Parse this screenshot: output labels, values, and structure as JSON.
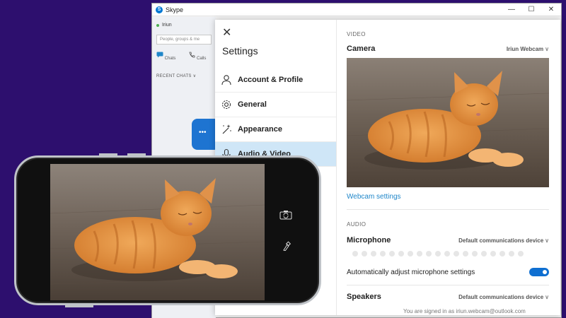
{
  "window": {
    "title": "Skype",
    "controls": [
      "—",
      "☐",
      "✕"
    ]
  },
  "left_panel": {
    "user_name": "Iriun",
    "search_placeholder": "People, groups & me",
    "nav": [
      {
        "label": "Chats",
        "icon": "chat-icon"
      },
      {
        "label": "Calls",
        "icon": "phone-icon"
      }
    ],
    "recent_label": "RECENT CHATS ∨"
  },
  "settings": {
    "close": "✕",
    "title": "Settings",
    "items": [
      {
        "label": "Account & Profile",
        "icon": "person-icon"
      },
      {
        "label": "General",
        "icon": "gear-icon"
      },
      {
        "label": "Appearance",
        "icon": "wand-icon"
      },
      {
        "label": "Audio & Video",
        "icon": "microphone-icon",
        "active": true
      }
    ]
  },
  "video": {
    "section": "VIDEO",
    "camera_label": "Camera",
    "camera_value": "Iriun Webcam",
    "webcam_link": "Webcam settings"
  },
  "audio": {
    "section": "AUDIO",
    "mic_label": "Microphone",
    "mic_value": "Default communications device",
    "auto_adjust_label": "Automatically adjust microphone settings",
    "auto_adjust_on": true,
    "speakers_label": "Speakers",
    "speakers_value": "Default communications device"
  },
  "footer_text": "You are signed in as iriun.webcam@outlook.com",
  "colors": {
    "accent": "#0f6fd1",
    "background": "#2d0f6e",
    "active_item": "#cfe6f7"
  }
}
